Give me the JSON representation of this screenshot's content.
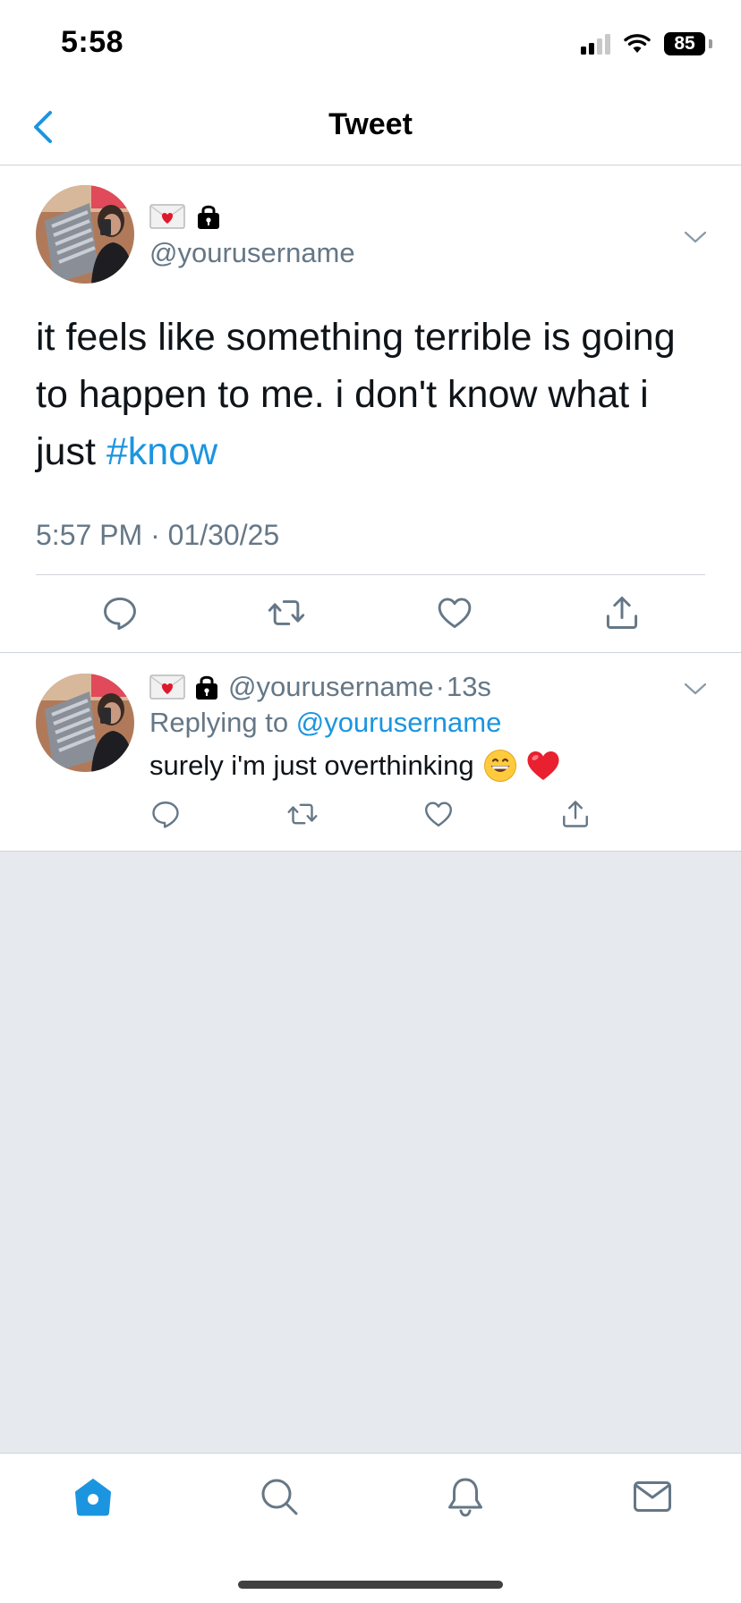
{
  "status_bar": {
    "time": "5:58",
    "battery": "85",
    "signal_bars_filled": 2,
    "signal_bars_total": 4
  },
  "header": {
    "title": "Tweet"
  },
  "main_tweet": {
    "badges": [
      "envelope-heart-icon",
      "lock-icon"
    ],
    "handle": "@yourusername",
    "text_prefix": "it feels like something terrible is going to happen to me. i don't know what i just ",
    "hashtag": "#know",
    "timestamp": "5:57 PM · 01/30/25",
    "actions": [
      "reply-icon",
      "retweet-icon",
      "like-icon",
      "share-icon"
    ]
  },
  "reply": {
    "badges": [
      "envelope-heart-icon",
      "lock-icon"
    ],
    "handle": "@yourusername",
    "separator": "·",
    "time_ago": "13s",
    "replying_label": "Replying to",
    "replying_handle": "@yourusername",
    "text": "surely i'm just overthinking",
    "emojis": [
      "grinning-face-emoji",
      "red-heart-emoji"
    ],
    "actions": [
      "reply-icon",
      "retweet-icon",
      "like-icon",
      "share-icon"
    ]
  },
  "tab_bar": {
    "tabs": [
      "home-icon",
      "search-icon",
      "notifications-icon",
      "messages-icon"
    ],
    "active_tab": "home-icon"
  },
  "colors": {
    "accent": "#1b95e0",
    "secondary_text": "#657786",
    "empty_bg": "#e6e9ed",
    "divider": "#cfd4d9"
  }
}
